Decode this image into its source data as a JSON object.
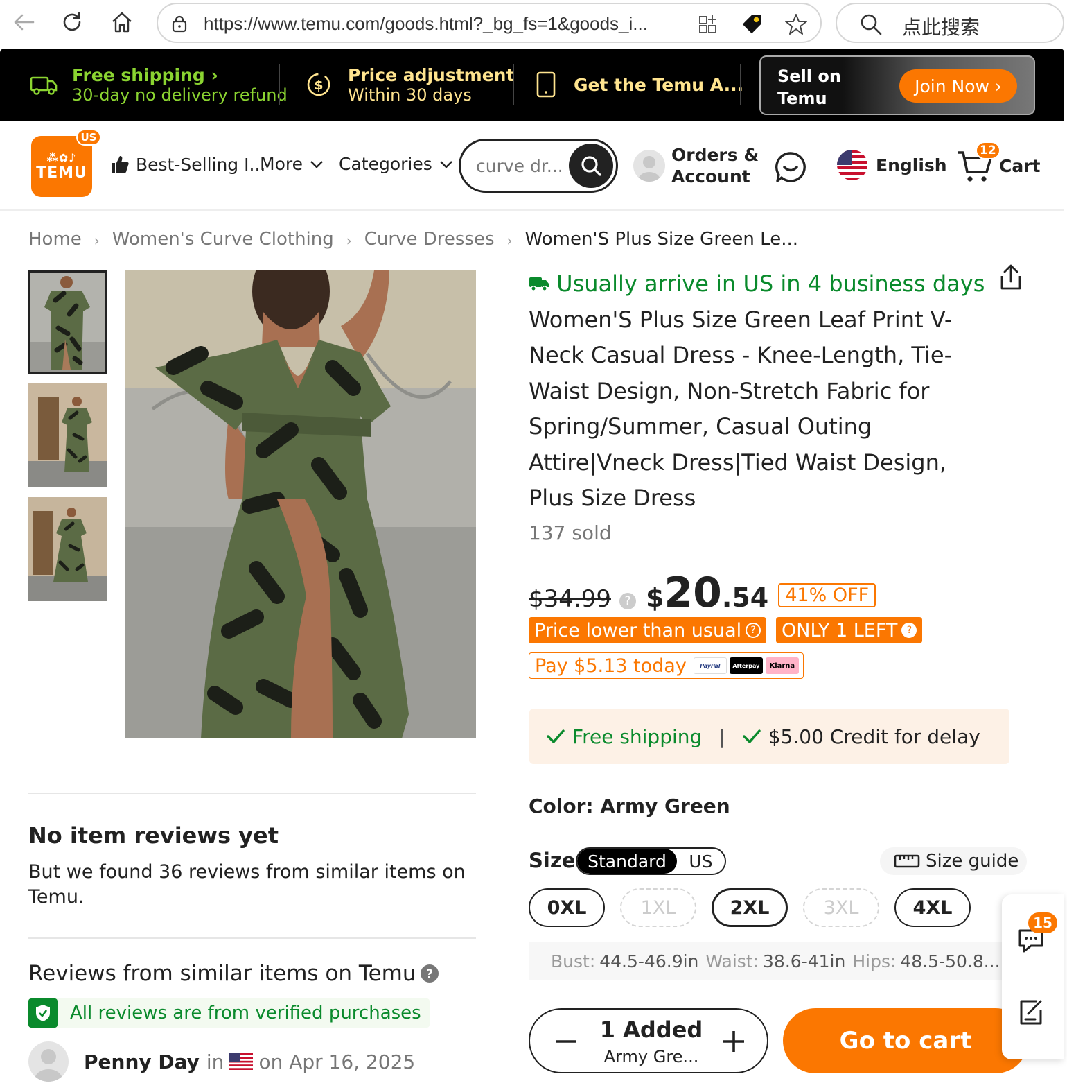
{
  "browser": {
    "url": "https://www.temu.com/goods.html?_bg_fs=1&goods_i...",
    "search_placeholder": "点此搜索"
  },
  "promo": {
    "free_shipping": "Free shipping",
    "free_shipping_sub": "30-day no delivery refund",
    "price_adjustment": "Price adjustment",
    "price_adjustment_sub": "Within 30 days",
    "app": "Get the Temu A...",
    "sell_line1": "Sell on",
    "sell_line2": "Temu",
    "join_now": "Join Now"
  },
  "header": {
    "logo_region": "US",
    "logo_text": "TEMU",
    "best_selling": "Best-Selling I...",
    "more": "More",
    "categories": "Categories",
    "search_value": "curve dr...",
    "orders_line1": "Orders &",
    "orders_line2": "Account",
    "language": "English",
    "cart_label": "Cart",
    "cart_count": "12"
  },
  "breadcrumb": {
    "home": "Home",
    "level1": "Women's Curve Clothing",
    "level2": "Curve Dresses",
    "current": "Women'S Plus Size Green Le..."
  },
  "product": {
    "arrival": "Usually arrive in US in 4 business days",
    "title": "Women'S Plus Size Green Leaf Print V-Neck Casual Dress - Knee-Length, Tie-Waist Design, Non-Stretch Fabric for Spring/Summer, Casual Outing Attire|Vneck Dress|Tied Waist Design, Plus Size Dress",
    "sold": "137 sold",
    "original_price": "$34.99",
    "price_symbol": "$",
    "price_int": "20",
    "price_dec": ".54",
    "discount": "41% OFF",
    "lower_tag": "Price lower than usual",
    "stock_tag": "ONLY 1 LEFT",
    "pay_today": "Pay $5.13 today",
    "pay_logos": [
      "PayPal",
      "Afterpay",
      "Klarna"
    ],
    "free_shipping": "Free shipping",
    "credit": "$5.00 Credit for delay",
    "color_label": "Color: Army Green",
    "size_label": "Size",
    "size_standard": "Standard",
    "size_us": "US",
    "size_guide": "Size guide",
    "sizes": [
      {
        "label": "0XL",
        "state": "available"
      },
      {
        "label": "1XL",
        "state": "disabled"
      },
      {
        "label": "2XL",
        "state": "selected"
      },
      {
        "label": "3XL",
        "state": "disabled"
      },
      {
        "label": "4XL",
        "state": "available"
      }
    ],
    "measure": {
      "bust_label": "Bust:",
      "bust": "44.5-46.9in",
      "waist_label": "Waist:",
      "waist": "38.6-41in",
      "hips_label": "Hips:",
      "hips": "48.5-50.8..."
    },
    "qty_added": "1 Added",
    "qty_variant": "Army Gre...",
    "go_to_cart": "Go to cart"
  },
  "reviews": {
    "no_reviews_title": "No item reviews yet",
    "no_reviews_body": "But we found 36 reviews from similar items on Temu.",
    "similar_title": "Reviews from similar items on Temu",
    "verified": "All reviews are from verified purchases",
    "reviewer_name": "Penny Day",
    "reviewer_in": "in",
    "reviewer_date": "on Apr 16, 2025"
  },
  "float_panel": {
    "chat_badge": "15"
  },
  "colors": {
    "brand_orange": "#fb7701",
    "success_green": "#0a8a2c",
    "promo_green": "#8bd431",
    "promo_yellow": "#ffe48f",
    "dress_green": "#5b6b45"
  }
}
